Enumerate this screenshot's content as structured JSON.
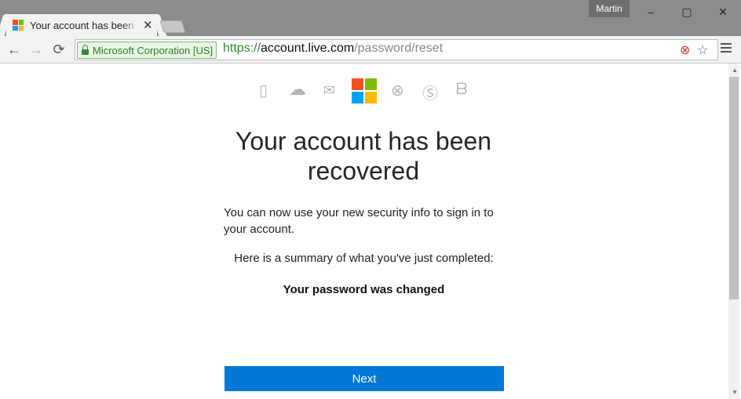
{
  "browser": {
    "tab_title": "Your account has been recovered",
    "tab_close": "✕",
    "user_name": "Martin",
    "win_minimize": "–",
    "win_maximize": "▢",
    "win_close": "✕",
    "ev_label": "Microsoft Corporation [US]",
    "url_scheme": "https://",
    "url_host": "account.live.com",
    "url_path": "/password/reset",
    "back_glyph": "←",
    "forward_glyph": "→",
    "reload_glyph": "⟳",
    "star_glyph": "☆",
    "ext_glyph": "⊗"
  },
  "page": {
    "product_icons": [
      "office-icon",
      "onedrive-icon",
      "outlook-icon",
      "microsoft-logo",
      "xbox-icon",
      "skype-icon",
      "bing-icon"
    ],
    "product_glyphs": {
      "office": "▯",
      "onedrive": "☁",
      "outlook": "✉",
      "xbox": "⊗",
      "skype": "Ⓢ",
      "bing": "ᗷ"
    },
    "headline": "Your account has been recovered",
    "intro": "You can now use your new security info to sign in to your account.",
    "summary_label": "Here is a summary of what you've just completed:",
    "completed_item": "Your password was changed",
    "next_label": "Next"
  },
  "colors": {
    "accent": "#0078d7",
    "ms_red": "#f25022",
    "ms_green": "#7fba00",
    "ms_blue": "#00a4ef",
    "ms_yellow": "#ffb900",
    "ev_green": "#2c7a2c"
  }
}
